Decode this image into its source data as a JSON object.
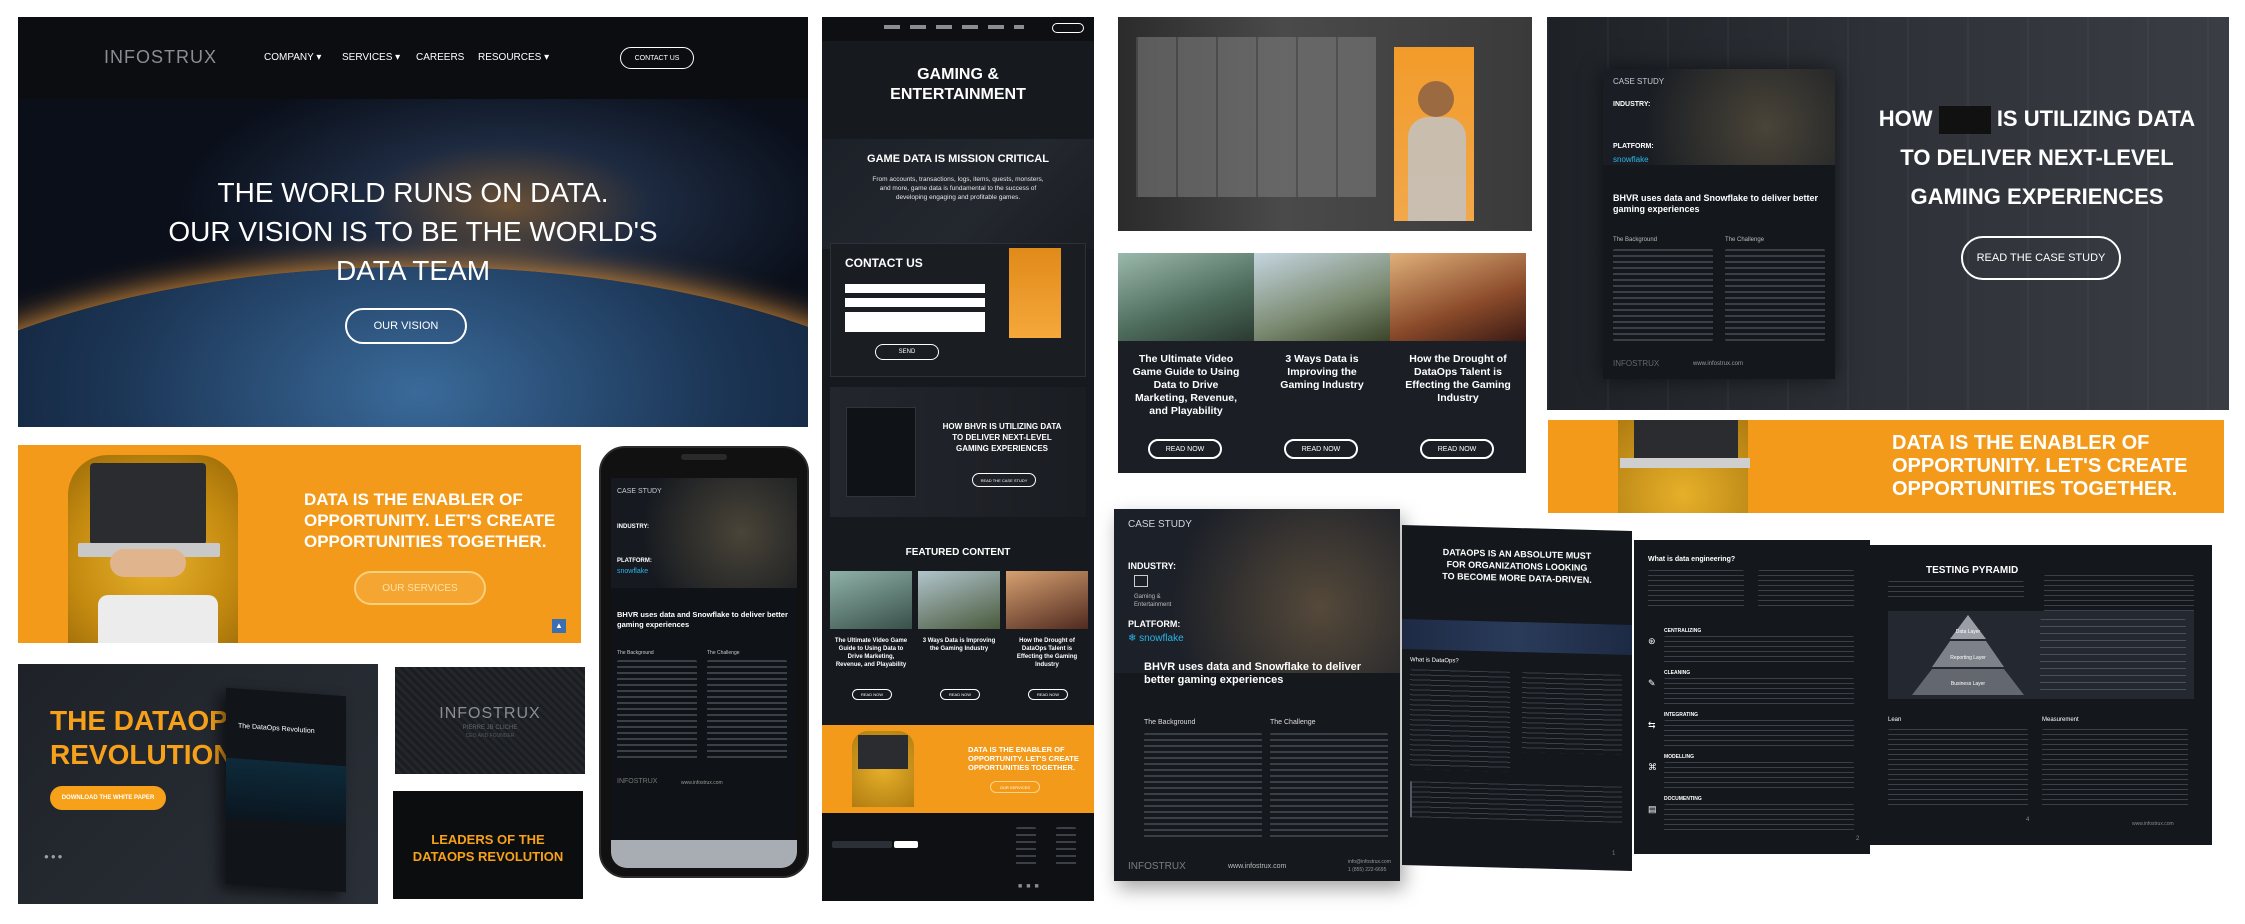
{
  "hero": {
    "logo": "INFOSTRUX",
    "nav": [
      "COMPANY",
      "SERVICES",
      "CAREERS",
      "RESOURCES"
    ],
    "contact": "CONTACT US",
    "headline": [
      "THE WORLD RUNS ON DATA.",
      "OUR VISION IS TO BE THE WORLD'S",
      "DATA TEAM"
    ],
    "cta": "OUR VISION"
  },
  "orange": {
    "text": [
      "DATA IS THE ENABLER OF",
      "OPPORTUNITY. LET'S CREATE",
      "OPPORTUNITIES TOGETHER."
    ],
    "cta": "OUR SERVICES"
  },
  "dataops": {
    "title": [
      "THE DATAOPS",
      "REVOLUTION"
    ],
    "cta": "DOWNLOAD THE WHITE PAPER",
    "book": "The DataOps Revolution"
  },
  "logo_tile": {
    "logo": "INFOSTRUX",
    "sub": [
      "PIERRE JB CLICHE",
      "CEO AND FOUNDER"
    ]
  },
  "leaders": {
    "text": [
      "LEADERS OF THE",
      "DATAOPS REVOLUTION"
    ]
  },
  "gaming": {
    "title": [
      "GAMING &",
      "ENTERTAINMENT"
    ],
    "mission": "GAME DATA IS MISSION CRITICAL",
    "mission_body": [
      "From accounts, transactions, logs, items, quests, monsters,",
      "and more, game data is fundamental to the success of",
      "developing engaging and profitable games."
    ],
    "contact": "CONTACT US",
    "send": "SEND",
    "how": [
      "HOW BHVR IS UTILIZING DATA",
      "TO DELIVER NEXT-LEVEL",
      "GAMING EXPERIENCES"
    ],
    "read_case": "READ THE CASE STUDY",
    "featured": "FEATURED CONTENT",
    "cards": [
      "The Ultimate Video Game Guide to Using Data to Drive Marketing, Revenue, and Playability",
      "3 Ways Data is Improving the Gaming Industry",
      "How the Drought of DataOps Talent is Effecting the Gaming Industry"
    ],
    "read_now": "READ NOW",
    "orange": [
      "DATA IS THE ENABLER OF",
      "OPPORTUNITY. LET'S CREATE",
      "OPPORTUNITIES TOGETHER."
    ],
    "our_services": "OUR SERVICES"
  },
  "articles": {
    "cards": [
      [
        "The Ultimate Video",
        "Game Guide to Using",
        "Data to Drive",
        "Marketing, Revenue,",
        "and Playability"
      ],
      [
        "3 Ways Data is",
        "Improving the",
        "Gaming Industry"
      ],
      [
        "How the Drought of",
        "DataOps Talent is",
        "Effecting the Gaming",
        "Industry"
      ]
    ],
    "read_now": "READ NOW"
  },
  "case_banner": {
    "label": "CASE STUDY",
    "industry": "INDUSTRY:",
    "platform": "PLATFORM:",
    "snowflake": "snowflake",
    "headline": "BHVR uses data and Snowflake to deliver better gaming experiences",
    "bg": "The Background",
    "challenge": "The Challenge",
    "footer_logo": "INFOSTRUX",
    "footer_url": "www.infostrux.com",
    "how": [
      "HOW",
      "IS UTILIZING DATA",
      "TO DELIVER NEXT-LEVEL",
      "GAMING EXPERIENCES"
    ],
    "cta": "READ THE CASE STUDY"
  },
  "orange2": {
    "text": [
      "DATA IS THE ENABLER OF",
      "OPPORTUNITY. LET'S CREATE",
      "OPPORTUNITIES TOGETHER."
    ]
  },
  "case_doc": {
    "label": "CASE STUDY",
    "industry": "INDUSTRY:",
    "industry_val": [
      "Gaming &",
      "Entertainment"
    ],
    "platform": "PLATFORM:",
    "snowflake": "snowflake",
    "headline": [
      "BHVR uses data and Snowflake to deliver",
      "better gaming experiences"
    ],
    "bg": "The Background",
    "challenge": "The Challenge",
    "footer_logo": "INFOSTRUX",
    "footer_url": "www.infostrux.com",
    "footer_email": "info@infostrux.com",
    "footer_phone": "1 (855) 222-6695"
  },
  "booklet": {
    "p1_title": [
      "DATAOPS IS AN ABSOLUTE MUST",
      "FOR ORGANIZATIONS LOOKING",
      "TO BECOME MORE DATA-DRIVEN."
    ],
    "p1_q": "What is DataOps?",
    "p2_title": "What is data engineering?",
    "p2_heads": [
      "CENTRALIZING",
      "CLEANING",
      "INTEGRATING",
      "MODELLING",
      "DOCUMENTING"
    ],
    "p3_title": "TESTING PYRAMID",
    "pyramid": [
      "Data Layer",
      "Reporting Layer",
      "Business Layer"
    ],
    "p3_heads": [
      "Lean",
      "Measurement"
    ],
    "url": "www.infostrux.com",
    "pages": [
      "1",
      "2",
      "4"
    ]
  },
  "colors": {
    "orange": "#f7a11a",
    "dark": "#14171c",
    "white": "#ffffff"
  }
}
